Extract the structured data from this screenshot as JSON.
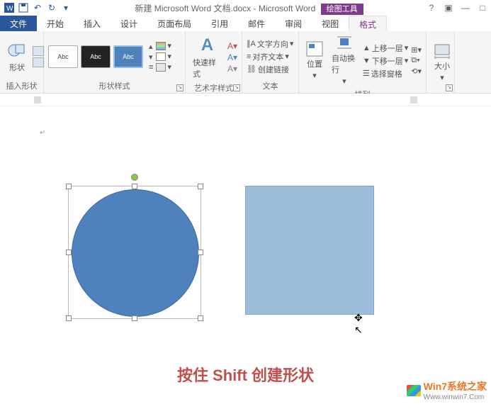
{
  "titlebar": {
    "title": "新建 Microsoft Word 文档.docx - Microsoft Word",
    "tool_tab": "绘图工具"
  },
  "tabs": {
    "file": "文件",
    "home": "开始",
    "insert": "插入",
    "design": "设计",
    "layout": "页面布局",
    "references": "引用",
    "mail": "邮件",
    "review": "审阅",
    "view": "视图",
    "format": "格式"
  },
  "ribbon": {
    "insert_shape": {
      "label": "形状",
      "group": "插入形状"
    },
    "shape_styles": {
      "abc": "Abc",
      "group": "形状样式"
    },
    "wordart": {
      "quick": "快速样式",
      "group": "艺术字样式"
    },
    "text": {
      "direction": "文字方向",
      "align": "对齐文本",
      "link": "创建链接",
      "group": "文本"
    },
    "position": "位置",
    "wrap": "自动换行",
    "arrange": {
      "bring_forward": "上移一层",
      "send_backward": "下移一层",
      "selection_pane": "选择窗格",
      "group": "排列"
    },
    "size": {
      "label": "大小"
    }
  },
  "caption": "按住 Shift 创建形状",
  "watermark": {
    "main": "Win7系统之家",
    "sub": "Www.winwin7.Com"
  }
}
